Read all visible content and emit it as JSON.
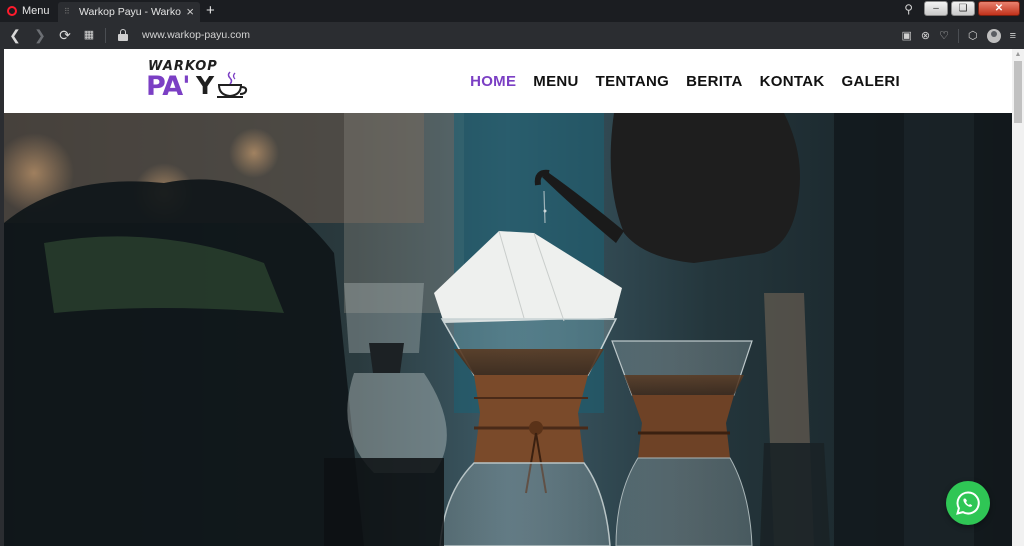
{
  "browser": {
    "menu_label": "Menu",
    "tab_title": "Warkop Payu - Warkop Pa",
    "tab_favicon": "loading-dot-icon",
    "new_tab": "+",
    "url": "www.warkop-payu.com"
  },
  "site": {
    "logo_top": "WARKOP",
    "logo_pa": "PA'",
    "logo_y": "Y",
    "nav": [
      {
        "label": "HOME",
        "active": true
      },
      {
        "label": "MENU",
        "active": false
      },
      {
        "label": "TENTANG",
        "active": false
      },
      {
        "label": "BERITA",
        "active": false
      },
      {
        "label": "KONTAK",
        "active": false
      },
      {
        "label": "GALERI",
        "active": false
      }
    ],
    "accent_color": "#7b3fc4",
    "hero_image": "coffee-pour-over-photo",
    "whatsapp_button_icon": "whatsapp-icon",
    "whatsapp_color": "#2fc655"
  }
}
